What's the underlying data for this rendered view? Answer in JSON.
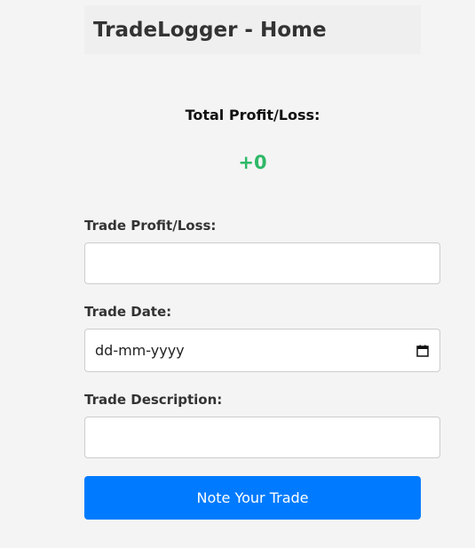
{
  "header": {
    "title": "TradeLogger - Home"
  },
  "summary": {
    "total_label": "Total Profit/Loss:",
    "total_value": "+0",
    "total_color": "#2eb866"
  },
  "form": {
    "profit_loss": {
      "label": "Trade Profit/Loss:",
      "value": ""
    },
    "date": {
      "label": "Trade Date:",
      "placeholder": "dd-mm-yyyy",
      "icon": "calendar-icon"
    },
    "description": {
      "label": "Trade Description:",
      "value": ""
    },
    "submit_label": "Note Your Trade",
    "submit_color": "#007bff"
  }
}
